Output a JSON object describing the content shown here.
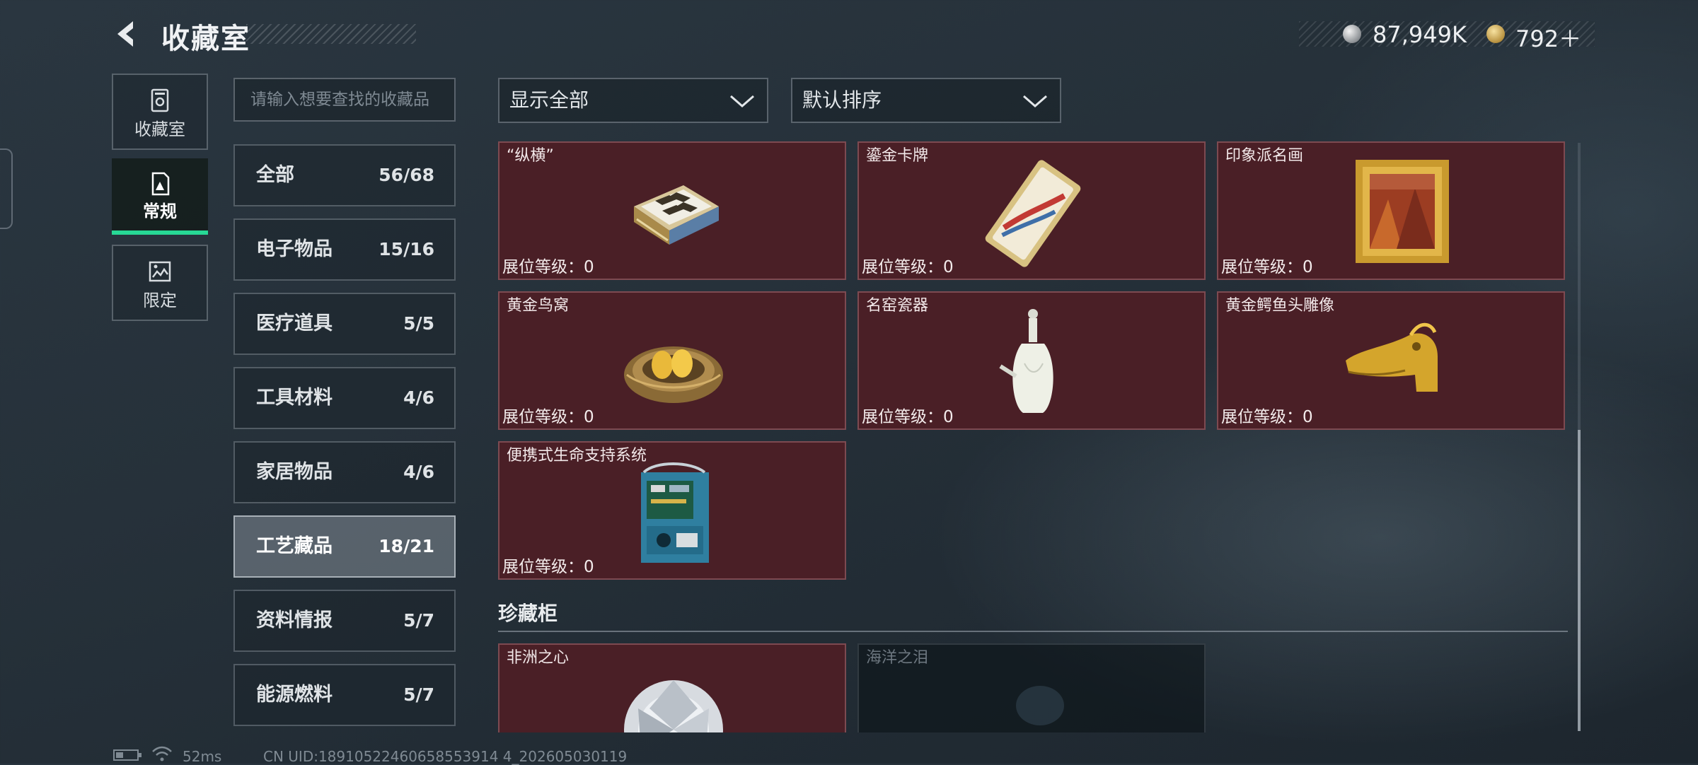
{
  "header": {
    "title": "收藏室",
    "currency_silver": "87,949K",
    "currency_gold": "792＋"
  },
  "nav": [
    {
      "label": "收藏室",
      "icon": "cabinet-icon"
    },
    {
      "label": "常规",
      "icon": "regular-collection-icon",
      "active": true
    },
    {
      "label": "限定",
      "icon": "limited-collection-icon"
    }
  ],
  "search": {
    "placeholder": "请输入想要查找的收藏品"
  },
  "categories": [
    {
      "label": "全部",
      "count": "56/68"
    },
    {
      "label": "电子物品",
      "count": "15/16"
    },
    {
      "label": "医疗道具",
      "count": "5/5"
    },
    {
      "label": "工具材料",
      "count": "4/6"
    },
    {
      "label": "家居物品",
      "count": "4/6"
    },
    {
      "label": "工艺藏品",
      "count": "18/21",
      "active": true
    },
    {
      "label": "资料情报",
      "count": "5/7"
    },
    {
      "label": "能源燃料",
      "count": "5/7"
    }
  ],
  "filters": {
    "display": "显示全部",
    "sort": "默认排序"
  },
  "level_label": "展位等级：0",
  "items": [
    {
      "name": "“纵横”",
      "icon": "chess-box-icon"
    },
    {
      "name": "鎏金卡牌",
      "icon": "gilded-card-icon"
    },
    {
      "name": "印象派名画",
      "icon": "framed-painting-icon"
    },
    {
      "name": "黄金鸟窝",
      "icon": "golden-nest-icon"
    },
    {
      "name": "名窑瓷器",
      "icon": "porcelain-vase-icon"
    },
    {
      "name": "黄金鳄鱼头雕像",
      "icon": "gold-crocodile-head-icon"
    },
    {
      "name": "便携式生命支持系统",
      "icon": "life-support-device-icon"
    }
  ],
  "treasure_section": {
    "title": "珍藏柜",
    "items": [
      {
        "name": "非洲之心",
        "icon": "diamond-icon",
        "owned": true
      },
      {
        "name": "海洋之泪",
        "icon": "ocean-tear-icon",
        "owned": false
      }
    ]
  },
  "status_bar": {
    "ping": "52ms",
    "uid": "CN UID:18910522460658553914 4_202605030119"
  },
  "colors": {
    "accent": "#27d895",
    "card_bg": "#4a1f26",
    "card_border": "#7d4a51"
  }
}
